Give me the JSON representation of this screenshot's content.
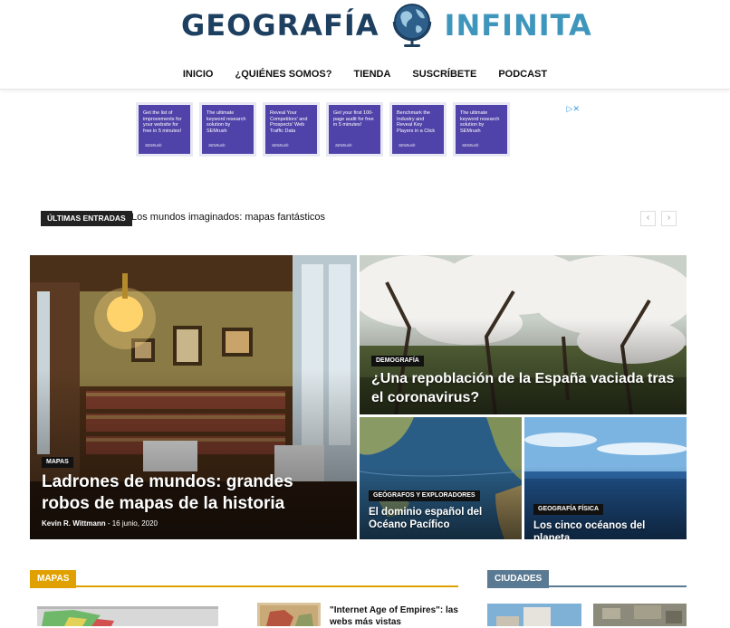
{
  "site": {
    "logo_left": "GEOGRAFÍA",
    "logo_right": "INFINITA",
    "colors": {
      "logo_dark": "#1d3f60",
      "logo_light": "#3f96bd",
      "maps_accent": "#e0a100",
      "cities_accent": "#5a7a93"
    }
  },
  "nav": [
    {
      "label": "INICIO"
    },
    {
      "label": "¿QUIÉNES SOMOS?"
    },
    {
      "label": "TIENDA"
    },
    {
      "label": "SUSCRÍBETE"
    },
    {
      "label": "PODCAST"
    }
  ],
  "ad": {
    "cards": [
      {
        "text": "Get the list of improvements for your website for free in 5 minutes!"
      },
      {
        "text": "The ultimate keyword research solution by SEMrush"
      },
      {
        "text": "Reveal Your Competitors' and Prospects' Web Traffic Data"
      },
      {
        "text": "Get your first 100-page audit for free in 5 minutes!"
      },
      {
        "text": "Benchmark the Industry and Reveal Key Players in a Click"
      },
      {
        "text": "The ultimate keyword research solution by SEMrush"
      }
    ],
    "brand": "SEMrush",
    "icons": "▷✕"
  },
  "ticker": {
    "label": "ÚLTIMAS ENTRADAS",
    "text": "Los mundos imaginados: mapas fantásticos",
    "prev": "‹",
    "next": "›"
  },
  "featured": {
    "main": {
      "category": "MAPAS",
      "title": "Ladrones de mundos: grandes robos de mapas de la historia",
      "author": "Kevin R. Wittmann",
      "date": "16 junio, 2020"
    },
    "top_right": {
      "category": "DEMOGRAFÍA",
      "title": "¿Una repoblación de la España vaciada tras el coronavirus?"
    },
    "bottom_left": {
      "category": "GEÓGRAFOS Y EXPLORADORES",
      "title": "El dominio español del Océano Pacífico"
    },
    "bottom_right": {
      "category": "GEOGRAFÍA FÍSICA",
      "title": "Los cinco océanos del planeta"
    }
  },
  "sections": {
    "maps": {
      "label": "MAPAS",
      "post_title": "\"Internet Age of Empires\": las webs más vistas"
    },
    "cities": {
      "label": "CIUDADES"
    }
  }
}
